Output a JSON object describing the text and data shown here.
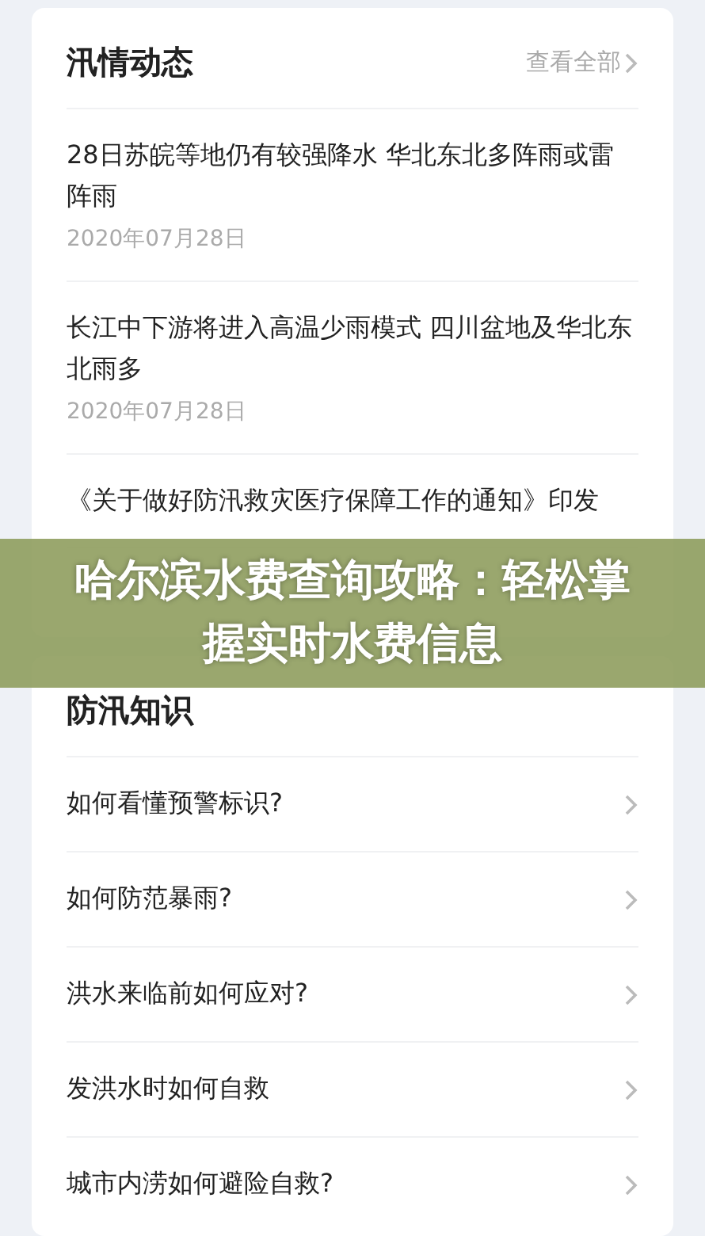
{
  "news_card": {
    "title": "汛情动态",
    "view_all": "查看全部",
    "items": [
      {
        "title": "28日苏皖等地仍有较强降水 华北东北多阵雨或雷阵雨",
        "date": "2020年07月28日"
      },
      {
        "title": "长江中下游将进入高温少雨模式 四川盆地及华北东北雨多",
        "date": "2020年07月28日"
      },
      {
        "title": "《关于做好防汛救灾医疗保障工作的通知》印发"
      }
    ]
  },
  "knowledge_card": {
    "title": "防汛知识",
    "items": [
      "如何看懂预警标识?",
      "如何防范暴雨?",
      "洪水来临前如何应对?",
      "发洪水时如何自救",
      "城市内涝如何避险自救?"
    ]
  },
  "banner": {
    "text": "哈尔滨水费查询攻略：轻松掌握实时水费信息"
  }
}
